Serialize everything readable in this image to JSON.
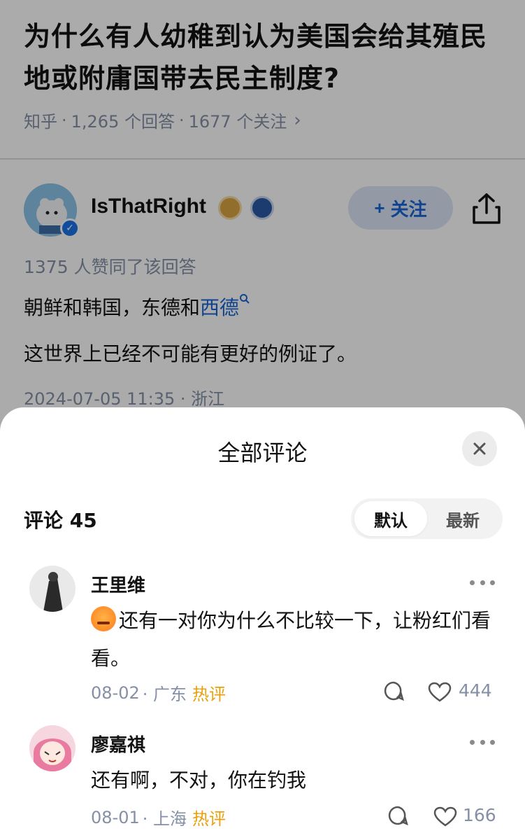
{
  "question": {
    "title": "为什么有人幼稚到认为美国会给其殖民地或附庸国带去民主制度?",
    "source": "知乎",
    "answers_count": "1,265 个回答",
    "followers_count": "1677 个关注",
    "separator": "·"
  },
  "answer": {
    "author": "IsThatRight",
    "follow_label": "关注",
    "follow_plus": "+",
    "agree_text": "1375 人赞同了该回答",
    "para1_before": "朝鲜和韩国，东德和",
    "para1_link": "西德",
    "para2": "这世界上已经不可能有更好的例证了。",
    "time_location": "2024-07-05 11:35 · 浙江"
  },
  "comments_sheet": {
    "title": "全部评论",
    "count_label": "评论 45",
    "sort_default": "默认",
    "sort_latest": "最新",
    "comments": [
      {
        "author": "王里维",
        "text": "还有一对你为什么不比较一下，让粉红们看看。",
        "emoji": "angry-face-emoji",
        "date": "08-02",
        "location": "· 广东",
        "tag": "热评",
        "likes": "444"
      },
      {
        "author": "廖嘉祺",
        "text": "还有啊，不对，你在钓我",
        "date": "08-01",
        "location": "· 上海",
        "tag": "热评",
        "likes": "166"
      }
    ]
  },
  "colors": {
    "accent_blue": "#1a66d6",
    "hot_tag": "#e8a10c",
    "muted_text": "#8590a6",
    "overlay": "rgba(0,0,0,0.33)"
  }
}
